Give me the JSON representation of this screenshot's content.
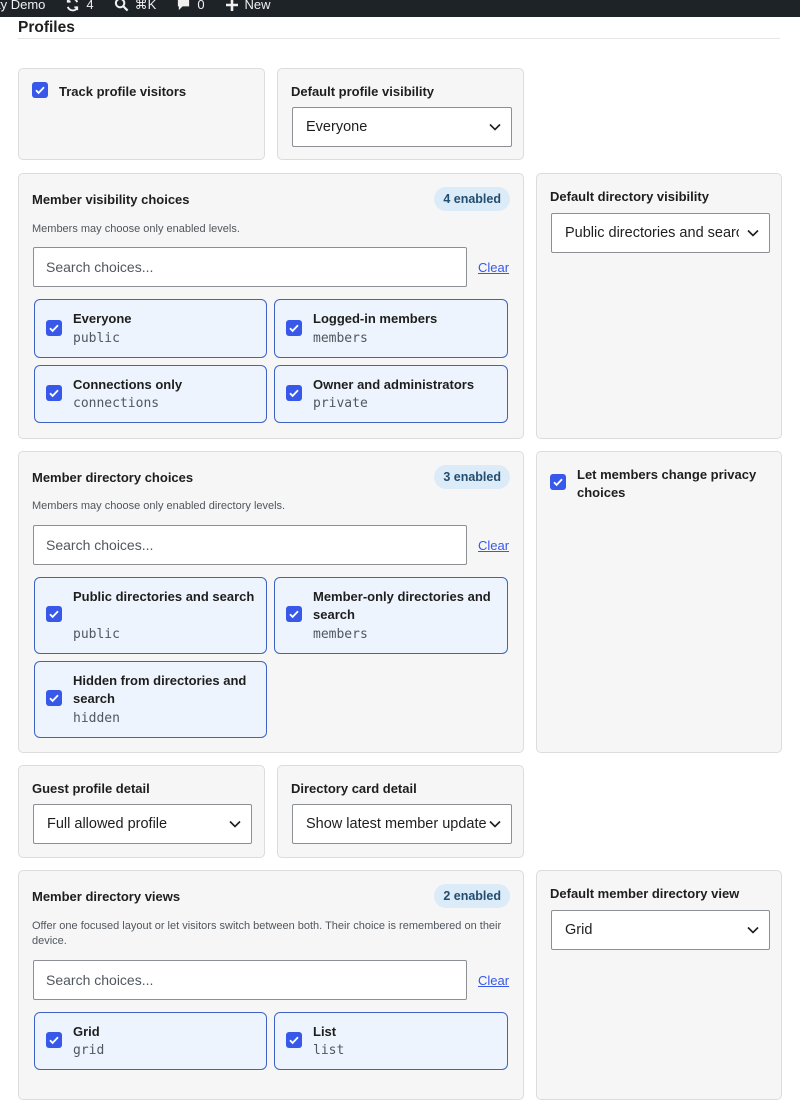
{
  "adminbar": {
    "site": "ty Demo",
    "updates": "4",
    "shortcut": "⌘K",
    "comments": "0",
    "new_label": "New"
  },
  "section_title": "Profiles",
  "track_visitors": {
    "label": "Track profile visitors",
    "checked": true
  },
  "default_profile_visibility": {
    "title": "Default profile visibility",
    "value": "Everyone"
  },
  "member_visibility": {
    "title": "Member visibility choices",
    "badge": "4 enabled",
    "help": "Members may choose only enabled levels.",
    "search_placeholder": "Search choices...",
    "clear": "Clear",
    "choices": [
      {
        "label": "Everyone",
        "slug": "public",
        "checked": true
      },
      {
        "label": "Logged-in members",
        "slug": "members",
        "checked": true
      },
      {
        "label": "Connections only",
        "slug": "connections",
        "checked": true
      },
      {
        "label": "Owner and administrators",
        "slug": "private",
        "checked": true
      }
    ]
  },
  "default_directory_visibility": {
    "title": "Default directory visibility",
    "value": "Public directories and search"
  },
  "member_directory": {
    "title": "Member directory choices",
    "badge": "3 enabled",
    "help": "Members may choose only enabled directory levels.",
    "search_placeholder": "Search choices...",
    "clear": "Clear",
    "choices": [
      {
        "label": "Public directories and search",
        "slug": "public",
        "checked": true
      },
      {
        "label": "Member-only directories and search",
        "slug": "members",
        "checked": true
      },
      {
        "label": "Hidden from directories and search",
        "slug": "hidden",
        "checked": true
      }
    ]
  },
  "let_members_change": {
    "label": "Let members change privacy choices",
    "checked": true
  },
  "guest_profile_detail": {
    "title": "Guest profile detail",
    "value": "Full allowed profile"
  },
  "directory_card_detail": {
    "title": "Directory card detail",
    "value": "Show latest member updates"
  },
  "member_directory_views": {
    "title": "Member directory views",
    "badge": "2 enabled",
    "help": "Offer one focused layout or let visitors switch between both. Their choice is remembered on their device.",
    "search_placeholder": "Search choices...",
    "clear": "Clear",
    "choices": [
      {
        "label": "Grid",
        "slug": "grid",
        "checked": true
      },
      {
        "label": "List",
        "slug": "list",
        "checked": true
      }
    ]
  },
  "default_member_directory_view": {
    "title": "Default member directory view",
    "value": "Grid"
  },
  "colors": {
    "accent": "#3858e9",
    "badge_bg": "#dcebf8",
    "choice_bg": "#eef4fd",
    "card_bg": "#f6f6f6"
  }
}
